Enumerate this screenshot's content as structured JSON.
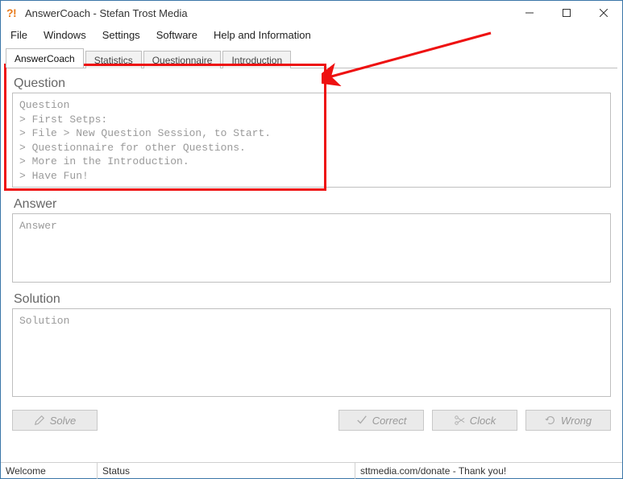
{
  "title": "AnswerCoach - Stefan Trost Media",
  "menu": {
    "items": [
      "File",
      "Windows",
      "Settings",
      "Software",
      "Help and Information"
    ]
  },
  "tabs": {
    "items": [
      "AnswerCoach",
      "Statistics",
      "Questionnaire",
      "Introduction"
    ],
    "activeIndex": 0
  },
  "panels": {
    "question": {
      "label": "Question",
      "text": "Question\n> First Setps:\n> File > New Question Session, to Start.\n> Questionnaire for other Questions.\n> More in the Introduction.\n> Have Fun!"
    },
    "answer": {
      "label": "Answer",
      "text": "Answer"
    },
    "solution": {
      "label": "Solution",
      "text": "Solution"
    }
  },
  "buttons": {
    "solve": "Solve",
    "correct": "Correct",
    "clock": "Clock",
    "wrong": "Wrong"
  },
  "status": {
    "left": "Welcome",
    "mid": "Status",
    "right": "sttmedia.com/donate - Thank you!"
  },
  "icons": {
    "app": "app-icon",
    "minimize": "minimize-icon",
    "maximize": "maximize-icon",
    "close": "close-icon",
    "solve": "pencil-icon",
    "correct": "check-icon",
    "clock": "scissors-icon",
    "wrong": "refresh-icon"
  }
}
